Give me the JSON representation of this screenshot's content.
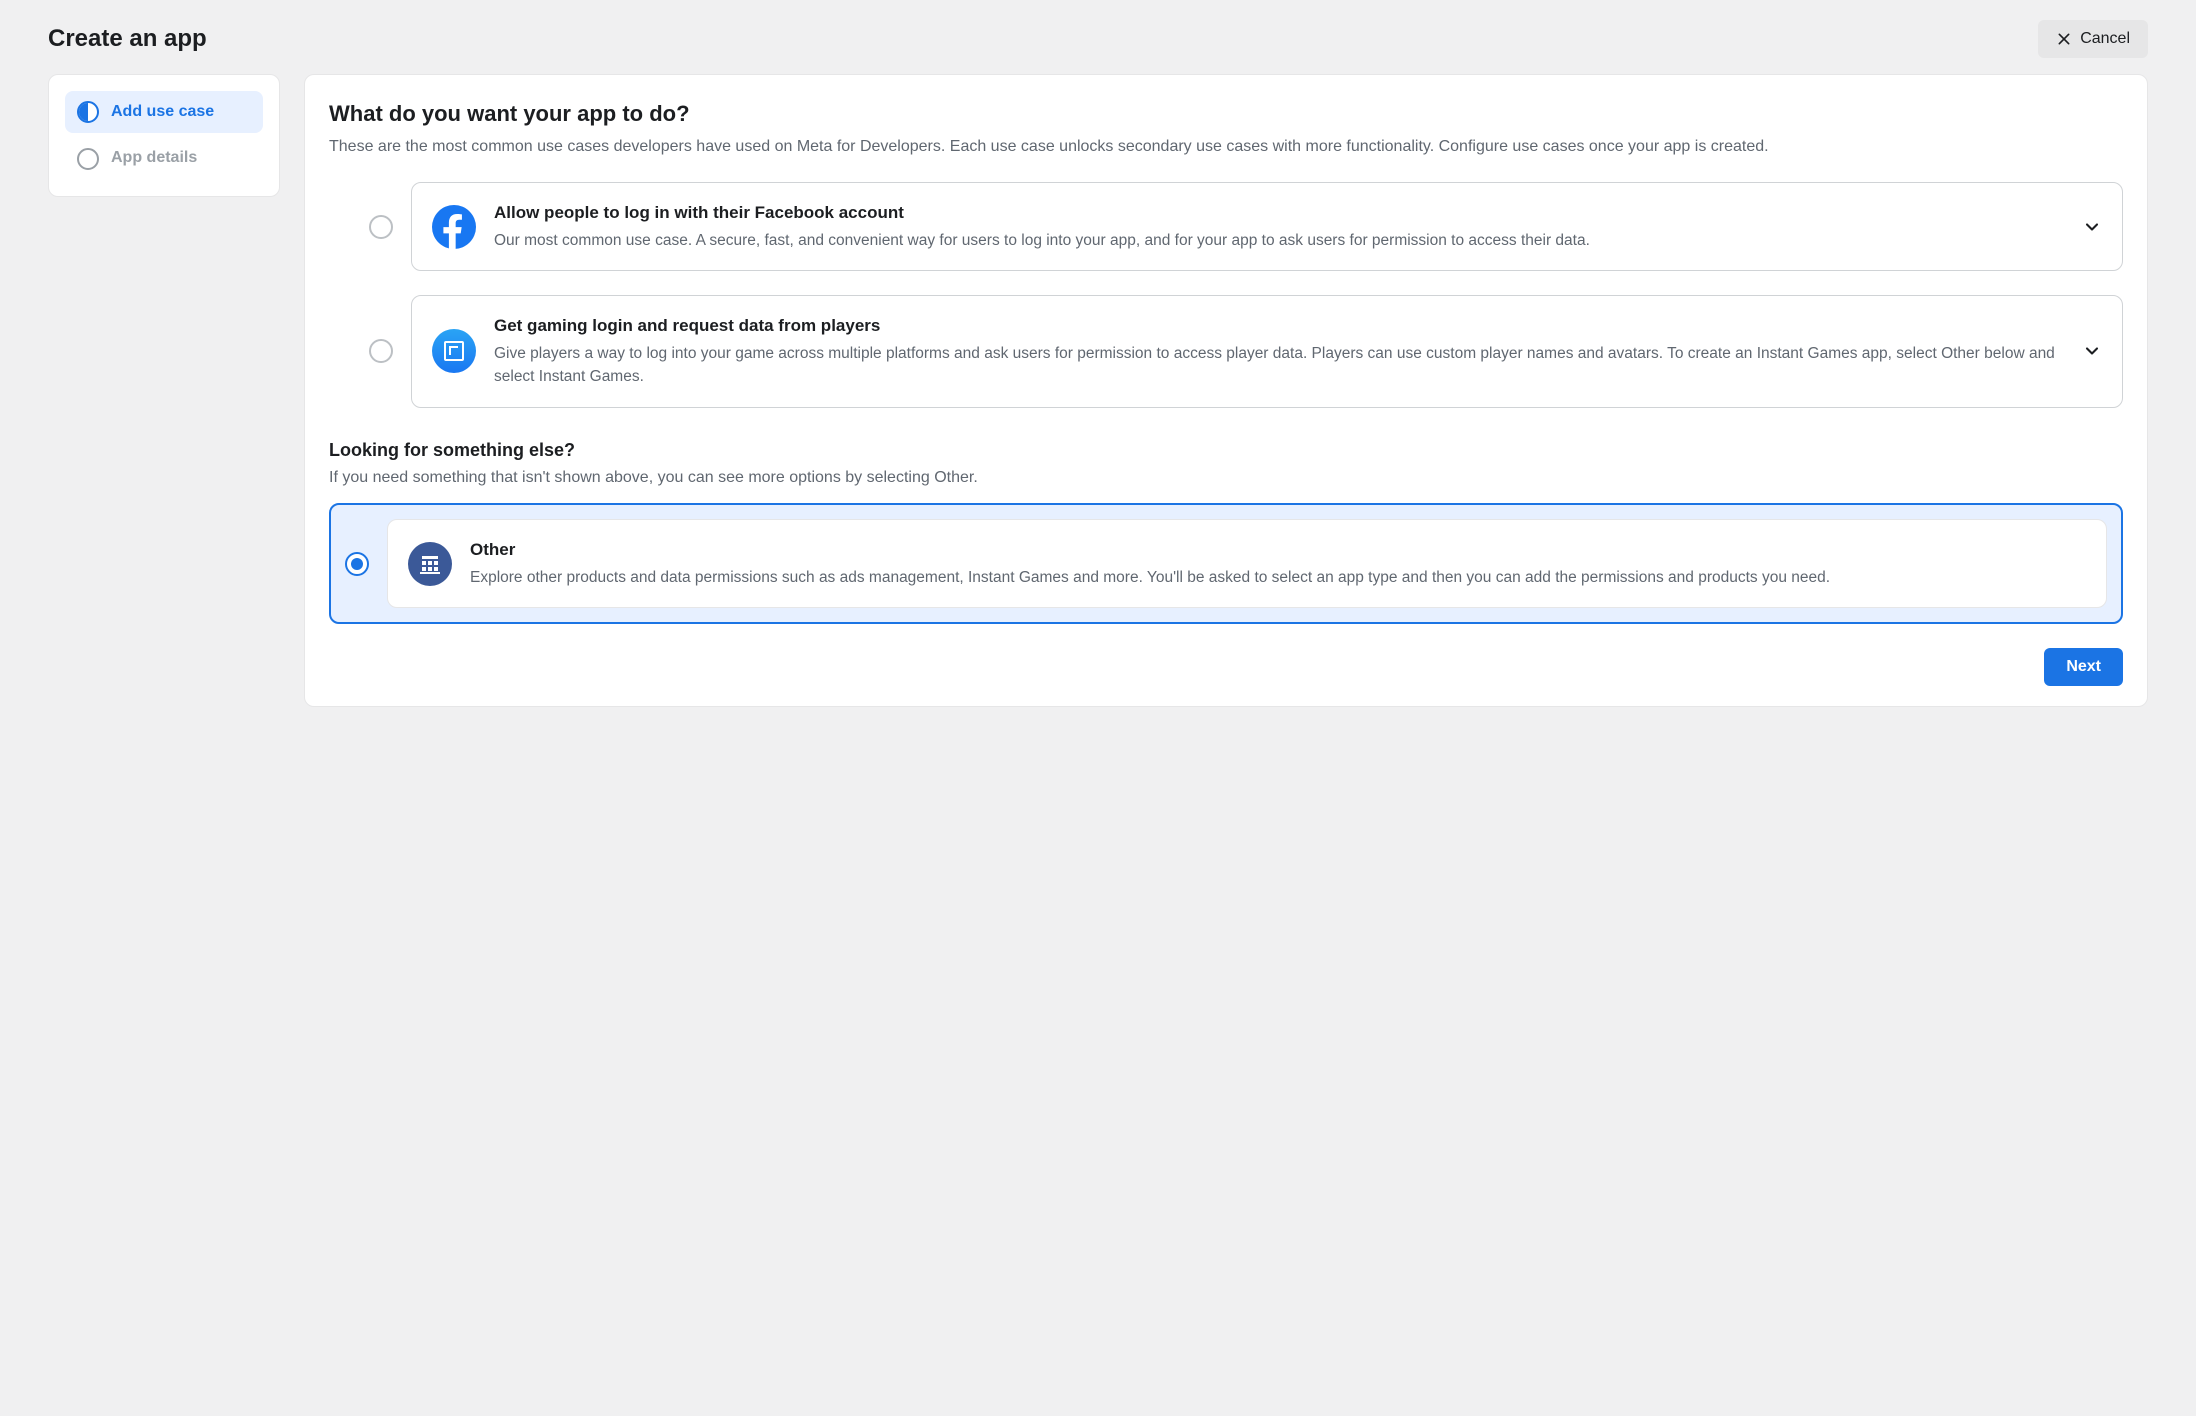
{
  "header": {
    "title": "Create an app",
    "cancel_label": "Cancel"
  },
  "sidebar": {
    "steps": [
      {
        "label": "Add use case",
        "active": true
      },
      {
        "label": "App details",
        "active": false
      }
    ]
  },
  "usecase": {
    "heading": "What do you want your app to do?",
    "description": "These are the most common use cases developers have used on Meta for Developers. Each use case unlocks secondary use cases with more functionality. Configure use cases once your app is created.",
    "options": [
      {
        "id": "fb-login",
        "title": "Allow people to log in with their Facebook account",
        "desc": "Our most common use case. A secure, fast, and convenient way for users to log into your app, and for your app to ask users for permission to access their data.",
        "icon": "facebook-icon",
        "expandable": true
      },
      {
        "id": "gaming",
        "title": "Get gaming login and request data from players",
        "desc": "Give players a way to log into your game across multiple platforms and ask users for permission to access player data. Players can use custom player names and avatars. To create an Instant Games app, select Other below and select Instant Games.",
        "icon": "gaming-icon",
        "expandable": true
      }
    ]
  },
  "something_else": {
    "heading": "Looking for something else?",
    "description": "If you need something that isn't shown above, you can see more options by selecting Other.",
    "option": {
      "id": "other",
      "title": "Other",
      "desc": "Explore other products and data permissions such as ads management, Instant Games and more. You'll be asked to select an app type and then you can add the permissions and products you need.",
      "icon": "building-icon",
      "selected": true
    }
  },
  "footer": {
    "next_label": "Next"
  },
  "colors": {
    "primary": "#1b74e4",
    "selected_bg": "#e7f0ff",
    "muted_text": "#606770"
  }
}
